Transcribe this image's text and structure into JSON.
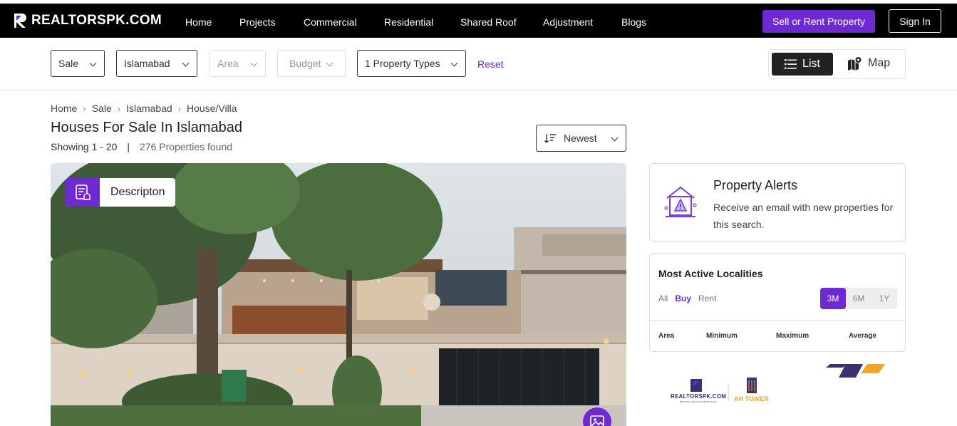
{
  "brand": {
    "name": "REALTORSPK.COM",
    "accent": "#6e29d3"
  },
  "nav": {
    "items": [
      "Home",
      "Projects",
      "Commercial",
      "Residential",
      "Shared Roof",
      "Adjustment",
      "Blogs"
    ],
    "sell_label": "Sell or Rent Property",
    "signin_label": "Sign In"
  },
  "filters": {
    "purpose": "Sale",
    "city": "Islamabad",
    "area": "Area",
    "budget": "Budget",
    "property_types": "1 Property Types",
    "reset": "Reset",
    "view_list": "List",
    "view_map": "Map"
  },
  "breadcrumb": [
    "Home",
    "Sale",
    "Islamabad",
    "House/Villa"
  ],
  "page": {
    "title": "Houses For Sale In Islamabad",
    "showing": "Showing 1 - 20",
    "found": "276 Properties found",
    "sort": "Newest"
  },
  "listing": {
    "description_label": "Descripton"
  },
  "alerts": {
    "title": "Property Alerts",
    "text": "Receive an email with new properties for this search."
  },
  "localities": {
    "title": "Most Active Localities",
    "tabs": [
      "All",
      "Buy",
      "Rent"
    ],
    "active_tab": "Buy",
    "periods": [
      "3M",
      "6M",
      "1Y"
    ],
    "active_period": "3M",
    "columns": [
      "Area",
      "Minimum",
      "Maximum",
      "Average"
    ]
  },
  "ad": {
    "brand": "REALTORSPK.COM",
    "tagline": "BEST REAL ESTATE MARKETPLACE",
    "partner": "AH TOWER"
  },
  "icons": [
    "logo-mark-icon",
    "chevron-down-icon",
    "list-icon",
    "map-icon",
    "sort-icon",
    "description-icon",
    "gallery-icon",
    "house-alert-icon"
  ]
}
